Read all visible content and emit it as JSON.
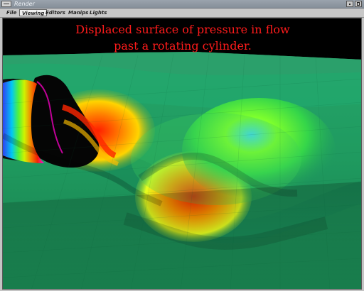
{
  "window": {
    "title": "Render",
    "controls": [
      "window-menu",
      "minimize",
      "maximize"
    ]
  },
  "menubar": {
    "items": [
      {
        "label": "File",
        "active": false
      },
      {
        "label": "Viewing",
        "active": true
      },
      {
        "label": "Editors",
        "active": false
      },
      {
        "label": "Manips",
        "active": false
      },
      {
        "label": "Lights",
        "active": false
      }
    ]
  },
  "viewport": {
    "caption_line1": "Displaced surface of pressure in flow",
    "caption_line2": "past a rotating cylinder.",
    "caption_color": "#ff1b1b",
    "background_color": "#000000",
    "surface_base_color": "#1f9c5d",
    "highlight_colors": [
      "#ff2a00",
      "#ff8c00",
      "#ffe100",
      "#7cff29",
      "#35d7ff",
      "#2850ff",
      "#ff00ff"
    ]
  }
}
